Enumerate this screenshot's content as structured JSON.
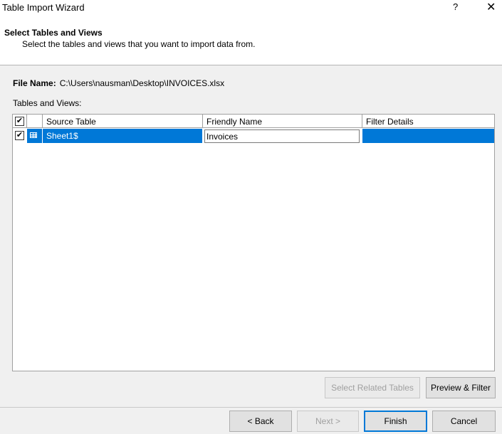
{
  "window": {
    "title": "Table Import Wizard",
    "help_glyph": "?",
    "close_glyph": "✕"
  },
  "header": {
    "title": "Select Tables and Views",
    "subtitle": "Select the tables and views that you want to import data from."
  },
  "file": {
    "label": "File Name:",
    "path": "C:\\Users\\nausman\\Desktop\\INVOICES.xlsx"
  },
  "tables_label": "Tables and Views:",
  "grid": {
    "columns": {
      "source": "Source Table",
      "friendly": "Friendly Name",
      "filter": "Filter Details"
    },
    "select_all_checked": true,
    "rows": [
      {
        "checked": true,
        "icon": "table-icon",
        "source": "Sheet1$",
        "friendly": "Invoices",
        "filter": ""
      }
    ]
  },
  "buttons": {
    "select_related": "Select Related Tables",
    "preview_filter": "Preview & Filter",
    "back": "< Back",
    "next": "Next >",
    "finish": "Finish",
    "cancel": "Cancel"
  },
  "colors": {
    "selection": "#0078d7",
    "header_bg": "#ffffff",
    "dialog_bg": "#f0f0f0"
  }
}
